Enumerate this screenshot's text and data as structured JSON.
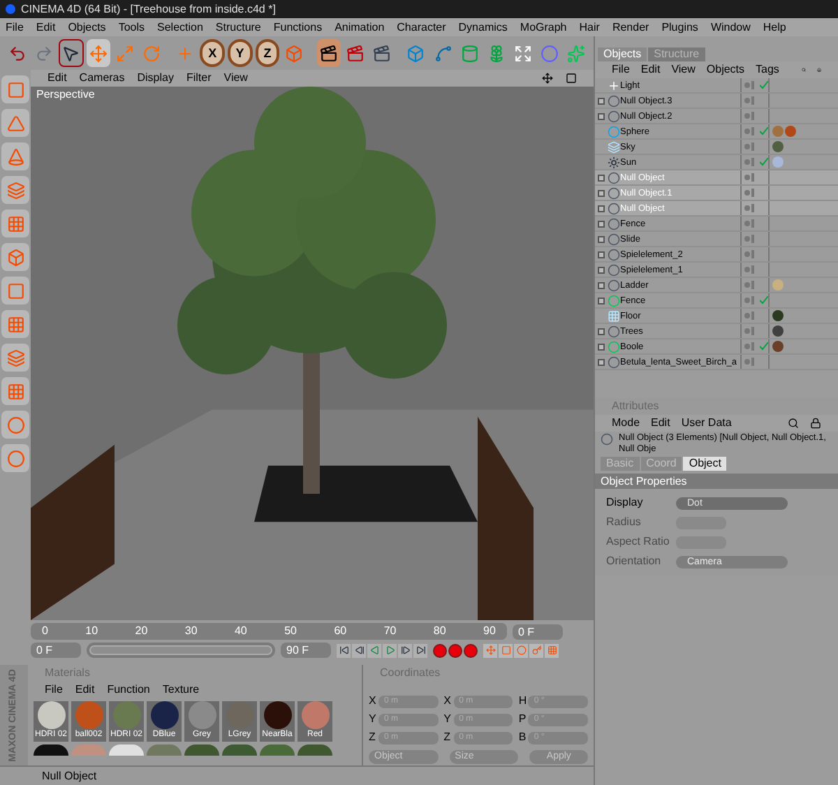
{
  "window": {
    "title": "CINEMA 4D (64 Bit) - [Treehouse from inside.c4d *]"
  },
  "menu": [
    "File",
    "Edit",
    "Objects",
    "Tools",
    "Selection",
    "Structure",
    "Functions",
    "Animation",
    "Character",
    "Dynamics",
    "MoGraph",
    "Hair",
    "Render",
    "Plugins",
    "Window",
    "Help"
  ],
  "toolbar": {
    "axis_buttons": [
      "X",
      "Y",
      "Z"
    ]
  },
  "viewport": {
    "menu": [
      "Edit",
      "Cameras",
      "Display",
      "Filter",
      "View"
    ],
    "camera_label": "Perspective"
  },
  "timeline": {
    "range_slider": {
      "level": 1
    },
    "ticks": [
      "0",
      "10",
      "20",
      "30",
      "40",
      "50",
      "60",
      "70",
      "80",
      "90"
    ],
    "current_frame": "0 F",
    "range_start": "0 F",
    "range_end": "90 F"
  },
  "materials": {
    "title": "Materials",
    "menu": [
      "File",
      "Edit",
      "Function",
      "Texture"
    ],
    "items": [
      {
        "name": "HDRI 02",
        "color": "#c8c8c0"
      },
      {
        "name": "ball002",
        "color": "#c0501a"
      },
      {
        "name": "HDRI 02",
        "color": "#6a7a50"
      },
      {
        "name": "DBlue",
        "color": "#1a2448"
      },
      {
        "name": "Grey",
        "color": "#8a8a8a"
      },
      {
        "name": "LGrey",
        "color": "#6e675e"
      },
      {
        "name": "NearBla",
        "color": "#2a1008"
      },
      {
        "name": "Red",
        "color": "#c07868"
      }
    ]
  },
  "coordinates": {
    "title": "Coordinates",
    "columns": [
      {
        "labels": [
          "X",
          "Y",
          "Z"
        ],
        "values": [
          "0 m",
          "0 m",
          "0 m"
        ]
      },
      {
        "labels": [
          "X",
          "Y",
          "Z"
        ],
        "values": [
          "0 m",
          "0 m",
          "0 m"
        ]
      },
      {
        "labels": [
          "H",
          "P",
          "B"
        ],
        "values": [
          "0 °",
          "0 °",
          "0 °"
        ]
      }
    ],
    "mode": "Object",
    "size_mode": "Size",
    "apply": "Apply"
  },
  "status_bar": "Null Object",
  "logo": "MAXON CINEMA 4D",
  "objects": {
    "tabs": [
      {
        "label": "Objects",
        "selected": true
      },
      {
        "label": "Structure",
        "selected": false
      }
    ],
    "menu": [
      "File",
      "Edit",
      "View",
      "Objects",
      "Tags"
    ],
    "items": [
      {
        "name": "Light",
        "kind": "light",
        "expandable": false,
        "selected": false,
        "checked": true
      },
      {
        "name": "Null Object.3",
        "kind": "null",
        "expandable": true,
        "selected": false,
        "checked": false
      },
      {
        "name": "Null Object.2",
        "kind": "null",
        "expandable": true,
        "selected": false,
        "checked": false
      },
      {
        "name": "Sphere",
        "kind": "sphere",
        "expandable": false,
        "selected": false,
        "checked": true,
        "tags": [
          {
            "color": "#a07040"
          },
          {
            "color": "#b04818"
          }
        ]
      },
      {
        "name": "Sky",
        "kind": "sky",
        "expandable": false,
        "selected": false,
        "checked": false,
        "tags": [
          {
            "color": "#506040"
          }
        ]
      },
      {
        "name": "Sun",
        "kind": "sun",
        "expandable": false,
        "selected": false,
        "checked": true,
        "tags": [
          {
            "color": "#a8b8d8"
          }
        ]
      },
      {
        "name": "Null Object",
        "kind": "null",
        "expandable": true,
        "selected": true,
        "checked": false
      },
      {
        "name": "Null Object.1",
        "kind": "null",
        "expandable": true,
        "selected": true,
        "checked": false
      },
      {
        "name": "Null Object",
        "kind": "null",
        "expandable": true,
        "selected": true,
        "checked": false
      },
      {
        "name": "Fence",
        "kind": "null",
        "expandable": true,
        "selected": false,
        "checked": false
      },
      {
        "name": "Slide",
        "kind": "null",
        "expandable": true,
        "selected": false,
        "checked": false
      },
      {
        "name": "Spielelement_2",
        "kind": "null",
        "expandable": true,
        "selected": false,
        "checked": false
      },
      {
        "name": "Spielelement_1",
        "kind": "null",
        "expandable": true,
        "selected": false,
        "checked": false
      },
      {
        "name": "Ladder",
        "kind": "null",
        "expandable": true,
        "selected": false,
        "checked": false,
        "tags": [
          {
            "color": "#c8b080"
          }
        ]
      },
      {
        "name": "Fence",
        "kind": "generator",
        "expandable": true,
        "selected": false,
        "checked": true
      },
      {
        "name": "Floor",
        "kind": "floor",
        "expandable": false,
        "selected": false,
        "checked": false,
        "tags": [
          {
            "color": "#2a3a20"
          }
        ]
      },
      {
        "name": "Trees",
        "kind": "null",
        "expandable": true,
        "selected": false,
        "checked": false,
        "tags": [
          {
            "color": "#404040"
          }
        ]
      },
      {
        "name": "Boole",
        "kind": "generator",
        "expandable": true,
        "selected": false,
        "checked": true,
        "tags": [
          {
            "color": "#6a4028"
          }
        ]
      },
      {
        "name": "Betula_lenta_Sweet_Birch_a",
        "kind": "null",
        "expandable": true,
        "selected": false,
        "checked": false
      }
    ]
  },
  "attributes": {
    "title": "Attributes",
    "menu": [
      "Mode",
      "Edit",
      "User Data"
    ],
    "header": "Null Object (3 Elements) [Null Object, Null Object.1, Null Obje",
    "tabs": [
      {
        "label": "Basic",
        "selected": false
      },
      {
        "label": "Coord",
        "selected": false
      },
      {
        "label": "Object",
        "selected": true
      }
    ],
    "section": "Object Properties",
    "fields": [
      {
        "label": "Display",
        "kind": "dropdown",
        "value": "Dot",
        "disabled": false
      },
      {
        "label": "Radius",
        "kind": "number",
        "disabled": true
      },
      {
        "label": "Aspect Ratio",
        "kind": "number",
        "disabled": true
      },
      {
        "label": "Orientation",
        "kind": "dropdown",
        "value": "Camera",
        "disabled": true
      }
    ]
  }
}
